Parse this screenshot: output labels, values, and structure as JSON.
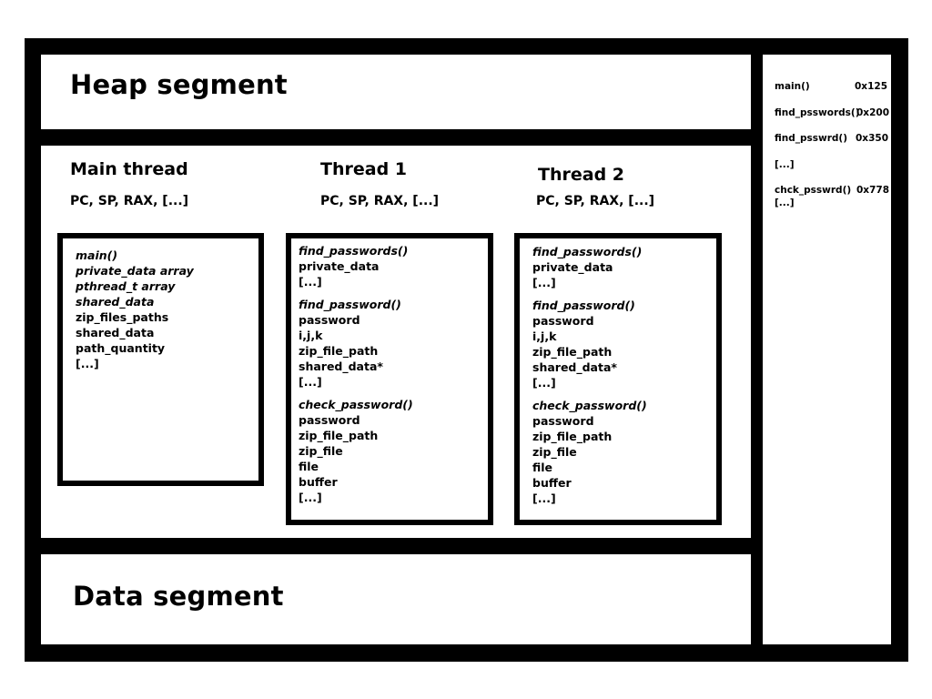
{
  "segments": {
    "heap": "Heap segment",
    "data": "Data segment"
  },
  "threads": [
    {
      "title": "Main thread",
      "registers": "PC, SP, RAX, [...]",
      "stack": [
        {
          "text": "main()",
          "italic": true
        },
        {
          "text": "private_data array",
          "italic": true
        },
        {
          "text": "pthread_t array",
          "italic": true
        },
        {
          "text": "shared_data",
          "italic": true
        },
        {
          "text": "zip_files_paths",
          "italic": false
        },
        {
          "text": "shared_data",
          "italic": false
        },
        {
          "text": "path_quantity",
          "italic": false
        },
        {
          "text": "[...]",
          "italic": false
        }
      ]
    },
    {
      "title": "Thread 1",
      "registers": "PC, SP, RAX, [...]",
      "frames": [
        {
          "name": "find_passwords()",
          "vars": [
            "private_data",
            "[...]"
          ]
        },
        {
          "name": "find_password()",
          "vars": [
            "password",
            "i,j,k",
            "zip_file_path",
            "shared_data*",
            "[...]"
          ]
        },
        {
          "name": "check_password()",
          "vars": [
            "password",
            "zip_file_path",
            "zip_file",
            "file",
            "buffer",
            "[...]"
          ]
        }
      ]
    },
    {
      "title": "Thread 2",
      "registers": "PC, SP, RAX, [...]",
      "frames": [
        {
          "name": "find_passwords()",
          "vars": [
            "private_data",
            "[...]"
          ]
        },
        {
          "name": "find_password()",
          "vars": [
            "password",
            "i,j,k",
            "zip_file_path",
            "shared_data*",
            "[...]"
          ]
        },
        {
          "name": "check_password()",
          "vars": [
            "password",
            "zip_file_path",
            "zip_file",
            "file",
            "buffer",
            "[...]"
          ]
        }
      ]
    }
  ],
  "symbols": [
    {
      "name": "main()",
      "addr": "0x125"
    },
    {
      "name": "find_psswords()",
      "addr": "0x200"
    },
    {
      "name": "find_psswrd()",
      "addr": "0x350"
    },
    {
      "name": "[...]",
      "addr": ""
    },
    {
      "name": "chck_psswrd()",
      "addr": "0x778"
    },
    {
      "name": "[...]",
      "addr": ""
    }
  ]
}
